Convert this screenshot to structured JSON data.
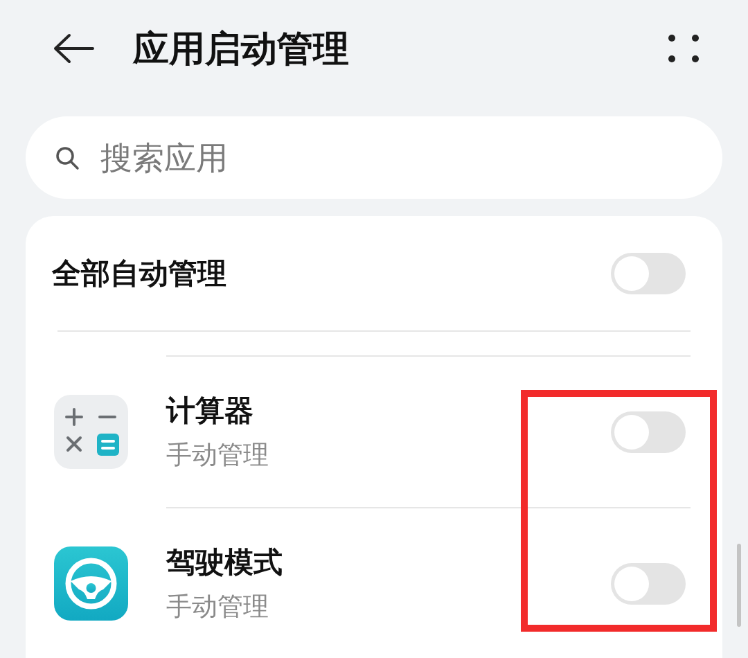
{
  "header": {
    "title": "应用启动管理"
  },
  "search": {
    "placeholder": "搜索应用"
  },
  "master": {
    "label": "全部自动管理",
    "on": false
  },
  "apps": [
    {
      "kind": "calculator",
      "name": "计算器",
      "mode": "手动管理",
      "on": false
    },
    {
      "kind": "driving",
      "name": "驾驶模式",
      "mode": "手动管理",
      "on": false
    }
  ],
  "annotations": [
    {
      "kind": "frame"
    }
  ]
}
